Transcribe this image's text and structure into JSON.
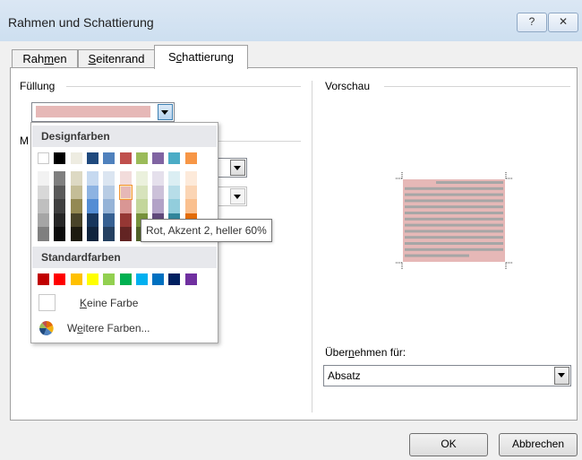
{
  "window": {
    "title": "Rahmen und Schattierung",
    "help_label": "?",
    "close_label": "✕"
  },
  "tabs": [
    {
      "pre": "Rah",
      "u": "m",
      "post": "en"
    },
    {
      "pre": "",
      "u": "S",
      "post": "eitenrand"
    },
    {
      "pre": "S",
      "u": "c",
      "post": "hattierung"
    }
  ],
  "fill": {
    "label": "Füllung",
    "selected_color": "#e6b8b7"
  },
  "pattern_label_fragment": "M",
  "color_popup": {
    "design_header": "Designfarben",
    "standard_header": "Standardfarben",
    "theme_top_row": [
      "#ffffff",
      "#000000",
      "#eeece1",
      "#1f497d",
      "#4f81bd",
      "#c0504d",
      "#9bbb59",
      "#8064a2",
      "#4bacc6",
      "#f79646"
    ],
    "theme_shades": [
      [
        "#f2f2f2",
        "#d8d8d8",
        "#bfbfbf",
        "#a5a5a5",
        "#7f7f7f"
      ],
      [
        "#7f7f7f",
        "#595959",
        "#3f3f3f",
        "#262626",
        "#0c0c0c"
      ],
      [
        "#ddd9c3",
        "#c4bd97",
        "#938953",
        "#494429",
        "#1d1b10"
      ],
      [
        "#c6d9f0",
        "#8db3e2",
        "#548dd4",
        "#17365d",
        "#0f243e"
      ],
      [
        "#dbe5f1",
        "#b8cce4",
        "#95b3d7",
        "#366092",
        "#244061"
      ],
      [
        "#f2dcdb",
        "#e6b8b7",
        "#d99694",
        "#953734",
        "#632423"
      ],
      [
        "#ebf1dd",
        "#d7e3bc",
        "#c3d69b",
        "#76923c",
        "#4f6128"
      ],
      [
        "#e5e0ec",
        "#ccc1d9",
        "#b2a2c7",
        "#5f497a",
        "#3f3151"
      ],
      [
        "#dbeef3",
        "#b7dde8",
        "#92cddc",
        "#31859b",
        "#205867"
      ],
      [
        "#fdeada",
        "#fbd5b5",
        "#fac08f",
        "#e36c09",
        "#974806"
      ]
    ],
    "standard_colors": [
      "#c00000",
      "#ff0000",
      "#ffc000",
      "#ffff00",
      "#92d050",
      "#00b050",
      "#00b0f0",
      "#0070c0",
      "#002060",
      "#7030a0"
    ],
    "no_color": {
      "pre": "",
      "u": "K",
      "post": "eine Farbe"
    },
    "more_colors": {
      "pre": "W",
      "u": "e",
      "post": "itere Farben..."
    },
    "tooltip": "Rot, Akzent 2, heller 60%"
  },
  "preview": {
    "label": "Vorschau",
    "shading_color": "#e6b8b7",
    "line_color": "#a6a6a6"
  },
  "apply_to": {
    "label_pre": "Über",
    "label_u": "n",
    "label_post": "ehmen für:",
    "value": "Absatz"
  },
  "buttons": {
    "ok": "OK",
    "cancel": "Abbrechen"
  }
}
